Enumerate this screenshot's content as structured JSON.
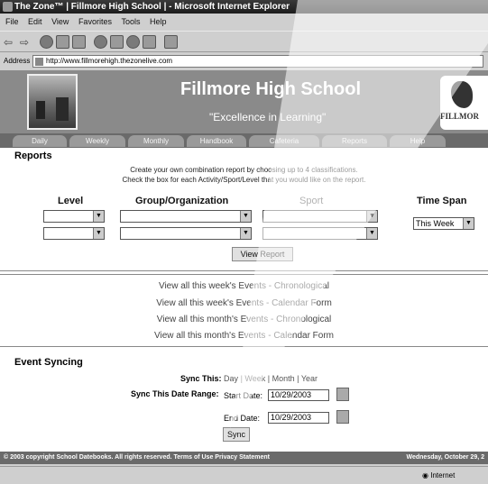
{
  "window": {
    "title": "The Zone™ | Fillmore High School | - Microsoft Internet Explorer"
  },
  "menu": [
    "File",
    "Edit",
    "View",
    "Favorites",
    "Tools",
    "Help"
  ],
  "address": {
    "label": "Address",
    "url": "http://www.fillmorehigh.thezonelive.com"
  },
  "banner": {
    "school_name": "Fillmore High School",
    "motto": "\"Excellence in Learning\"",
    "mascot_text": "FILLMOR"
  },
  "nav": [
    "Daily",
    "Weekly",
    "Monthly",
    "Handbook",
    "Cafeteria",
    "Reports",
    "Help"
  ],
  "reports": {
    "title": "Reports",
    "instruction_1": "Create your own combination report by choosing up to 4 classifications.",
    "instruction_2": "Check the box for each Activity/Sport/Level that you would like on the report.",
    "columns": [
      "Level",
      "Group/Organization",
      "Sport",
      "Time Span"
    ],
    "time_span_value": "This Week",
    "view_button": "View Report"
  },
  "event_links": [
    "View all this week's Events - Chronological",
    "View all this week's Events - Calendar Form",
    "View all this month's Events - Chronological",
    "View all this month's Events - Calendar Form"
  ],
  "syncing": {
    "title": "Event Syncing",
    "sync_this_label": "Sync This:",
    "options": [
      "Day",
      "Week",
      "Month",
      "Year"
    ],
    "range_label": "Sync This Date Range:",
    "start_label": "Start Date:",
    "start_value": "10/29/2003",
    "end_label": "End Date:",
    "end_value": "10/29/2003",
    "sync_button": "Sync"
  },
  "footer": {
    "left": "© 2003 copyright School Datebooks.  All rights reserved.  Terms of Use  Privacy Statement",
    "right": "Wednesday, October 29, 2"
  },
  "status": {
    "zone": "Internet"
  }
}
